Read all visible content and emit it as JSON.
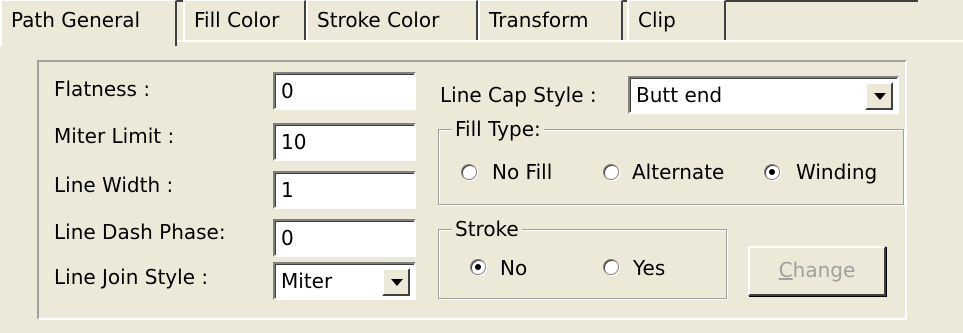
{
  "tabs": [
    {
      "label": "Path General",
      "active": true
    },
    {
      "label": "Fill Color",
      "active": false
    },
    {
      "label": "Stroke Color",
      "active": false
    },
    {
      "label": "Transform",
      "active": false
    },
    {
      "label": "Clip",
      "active": false
    }
  ],
  "fields": {
    "flatness": {
      "label": "Flatness :",
      "value": "0"
    },
    "miter_limit": {
      "label": "Miter Limit :",
      "value": "10"
    },
    "line_width": {
      "label": "Line Width :",
      "value": "1"
    },
    "line_dash_phase": {
      "label": "Line Dash Phase:",
      "value": "0"
    },
    "line_join_style": {
      "label": "Line Join Style :",
      "value": "Miter"
    },
    "line_cap_style": {
      "label": "Line Cap Style :",
      "value": "Butt end"
    }
  },
  "fill_type": {
    "title": "Fill Type:",
    "options": [
      {
        "label": "No Fill",
        "selected": false
      },
      {
        "label": "Alternate",
        "selected": false
      },
      {
        "label": "Winding",
        "selected": true
      }
    ]
  },
  "stroke": {
    "title": "Stroke",
    "options": [
      {
        "label": "No",
        "selected": true
      },
      {
        "label": "Yes",
        "selected": false
      }
    ]
  },
  "change_button": {
    "mnemonic": "C",
    "rest": "hange",
    "enabled": false
  },
  "colors": {
    "window_bg": "#ece9d8",
    "disabled_text": "#a0a0a0"
  },
  "icons": [
    "chevron-down-icon",
    "radio-icon"
  ]
}
